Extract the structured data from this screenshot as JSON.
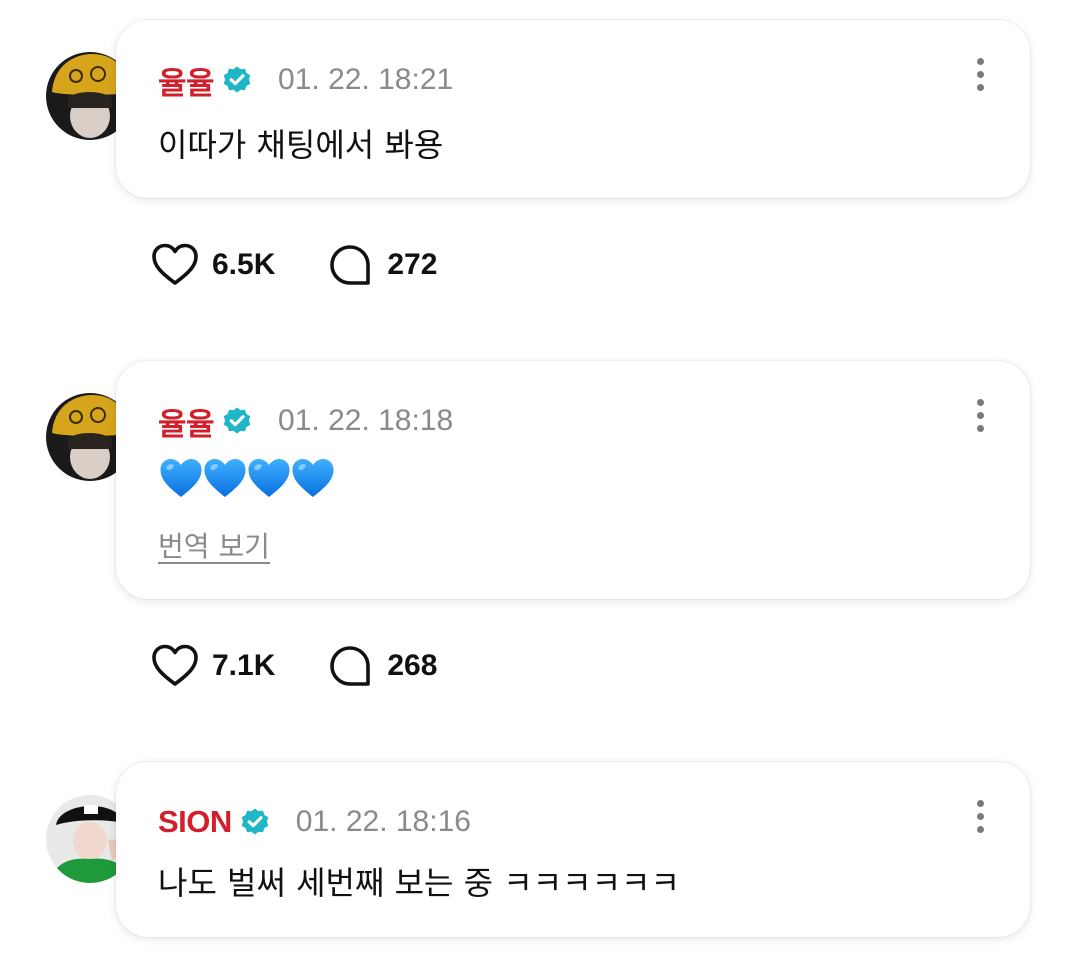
{
  "comments": [
    {
      "author": "율율",
      "verified_icon": "verified-check-icon",
      "time": "01. 22. 18:21",
      "text": "이따가 채팅에서 봐용",
      "likes": "6.5K",
      "replies": "272"
    },
    {
      "author": "율율",
      "verified_icon": "verified-check-icon",
      "time": "01. 22. 18:18",
      "text": "💙💙💙💙",
      "translate_label": "번역 보기",
      "likes": "7.1K",
      "replies": "268"
    },
    {
      "author": "SION",
      "verified_icon": "verified-check-icon",
      "time": "01. 22. 18:16",
      "text": "나도 벌써 세번째 보는 중 ㅋㅋㅋㅋㅋㅋ"
    }
  ],
  "colors": {
    "author_name": "#d11f2b",
    "verified_badge": "#1fb6c8",
    "heart_emoji": "#1e90ff",
    "timestamp": "#8a8a8a"
  }
}
